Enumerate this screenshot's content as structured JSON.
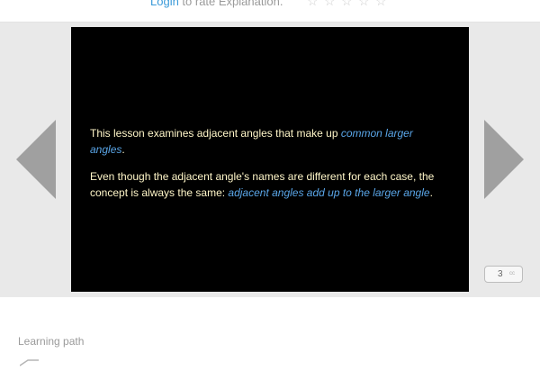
{
  "rating": {
    "login_label": "Login",
    "prompt": " to rate Explanation.",
    "stars": [
      "☆",
      "☆",
      "☆",
      "☆",
      "☆"
    ]
  },
  "slide": {
    "p1_prefix": "This lesson examines adjacent angles that make up ",
    "p1_highlight": "common larger angles",
    "p1_suffix": ".",
    "p2_prefix": "Even though the adjacent angle's names are different for each case, the concept is always the same: ",
    "p2_highlight": "adjacent angles add up to the larger angle",
    "p2_suffix": "."
  },
  "navigation": {
    "prev_icon": "triangle-left",
    "next_icon": "triangle-right",
    "page_number": "3",
    "page_badge_suffix": "cc"
  },
  "learning_path": {
    "label": "Learning path",
    "icon": "path-icon"
  },
  "colors": {
    "accent": "#3a9ad9",
    "slide_bg": "#000000",
    "slide_text": "#fff6c8",
    "highlight": "#5aa6e8",
    "stage_bg": "#e9e9e9",
    "arrow": "#a0a0a0"
  }
}
